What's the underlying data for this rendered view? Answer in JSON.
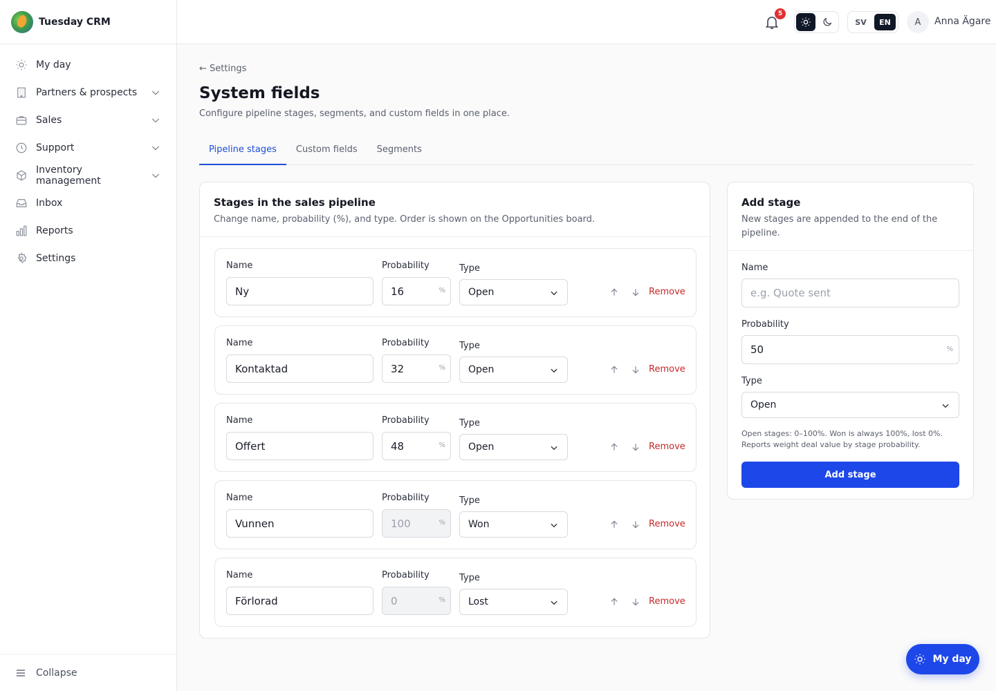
{
  "app": {
    "name": "Tuesday CRM"
  },
  "sidebar": {
    "items": [
      {
        "label": "My day",
        "icon": "sun-icon",
        "expandable": false
      },
      {
        "label": "Partners & prospects",
        "icon": "building-icon",
        "expandable": true
      },
      {
        "label": "Sales",
        "icon": "briefcase-icon",
        "expandable": true
      },
      {
        "label": "Support",
        "icon": "lifebuoy-icon",
        "expandable": true
      },
      {
        "label": "Inventory management",
        "icon": "box-icon",
        "expandable": true
      },
      {
        "label": "Inbox",
        "icon": "inbox-icon",
        "expandable": false
      },
      {
        "label": "Reports",
        "icon": "bar-chart-icon",
        "expandable": false
      },
      {
        "label": "Settings",
        "icon": "gear-icon",
        "expandable": false
      }
    ],
    "collapse_label": "Collapse"
  },
  "topbar": {
    "notification_count": "5",
    "lang_sv": "SV",
    "lang_en": "EN",
    "active_lang": "EN",
    "avatar_initial": "A",
    "user_name": "Anna Ägare"
  },
  "page": {
    "back_label": "← Settings",
    "title": "System fields",
    "subtitle": "Configure pipeline stages, segments, and custom fields in one place.",
    "tabs": [
      {
        "label": "Pipeline stages",
        "active": true
      },
      {
        "label": "Custom fields",
        "active": false
      },
      {
        "label": "Segments",
        "active": false
      }
    ]
  },
  "stages": {
    "title": "Stages in the sales pipeline",
    "description": "Change name, probability (%), and type. Order is shown on the Opportunities board.",
    "labels": {
      "name": "Name",
      "probability": "Probability",
      "type": "Type",
      "remove": "Remove",
      "percent": "%"
    },
    "rows": [
      {
        "name": "Ny",
        "probability": "16",
        "type": "Open",
        "locked": false
      },
      {
        "name": "Kontaktad",
        "probability": "32",
        "type": "Open",
        "locked": false
      },
      {
        "name": "Offert",
        "probability": "48",
        "type": "Open",
        "locked": false
      },
      {
        "name": "Vunnen",
        "probability": "100",
        "type": "Won",
        "locked": true
      },
      {
        "name": "Förlorad",
        "probability": "0",
        "type": "Lost",
        "locked": true
      }
    ]
  },
  "add_stage": {
    "title": "Add stage",
    "description": "New stages are appended to the end of the pipeline.",
    "name_label": "Name",
    "name_placeholder": "e.g. Quote sent",
    "probability_label": "Probability",
    "probability_value": "50",
    "percent": "%",
    "type_label": "Type",
    "type_value": "Open",
    "hint": "Open stages: 0–100%. Won is always 100%, lost 0%. Reports weight deal value by stage probability.",
    "button_label": "Add stage"
  },
  "fab": {
    "label": "My day"
  },
  "colors": {
    "accent": "#1d47e8",
    "tab_active": "#1d4ed8",
    "danger": "#c62828",
    "badge": "#e03131"
  }
}
